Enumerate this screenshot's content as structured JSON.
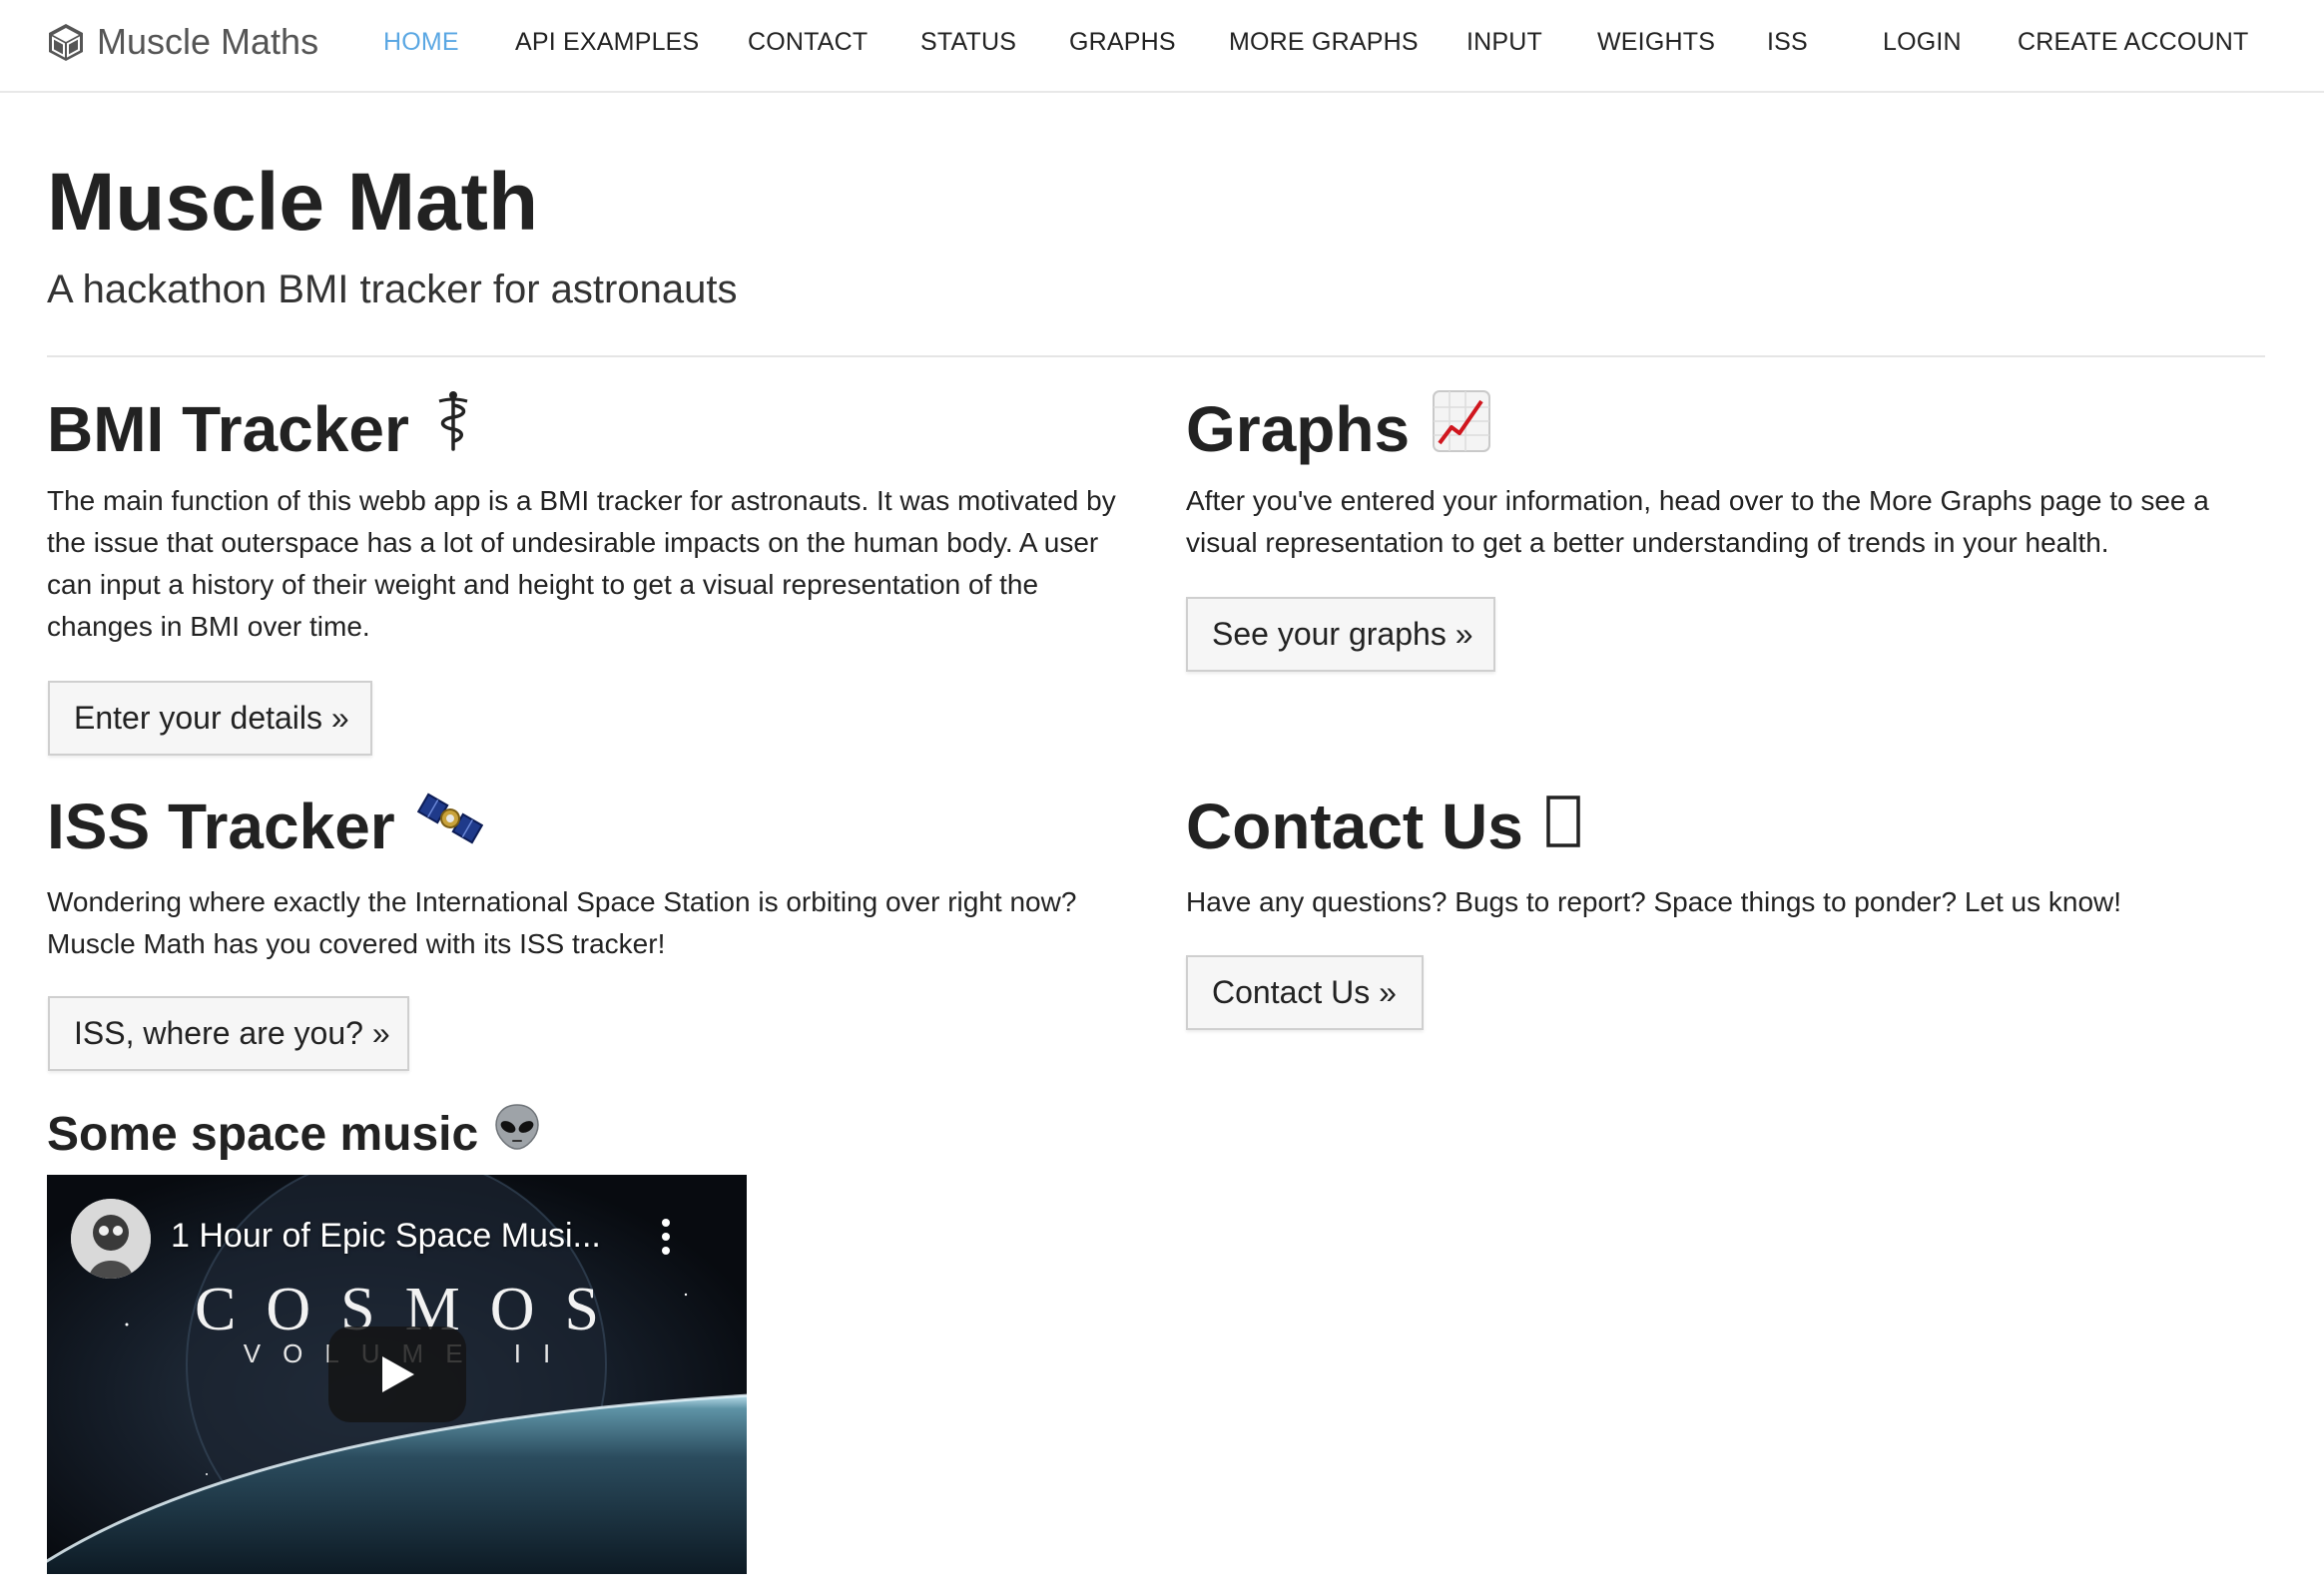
{
  "navbar": {
    "brand": "Muscle Maths",
    "brand_icon": "cube-icon",
    "links": [
      {
        "label": "HOME",
        "active": true
      },
      {
        "label": "API EXAMPLES",
        "active": false
      },
      {
        "label": "CONTACT",
        "active": false
      },
      {
        "label": "STATUS",
        "active": false
      },
      {
        "label": "GRAPHS",
        "active": false
      },
      {
        "label": "MORE GRAPHS",
        "active": false
      },
      {
        "label": "INPUT",
        "active": false
      },
      {
        "label": "WEIGHTS",
        "active": false
      },
      {
        "label": "ISS",
        "active": false
      }
    ],
    "login": "LOGIN",
    "create_account": "CREATE ACCOUNT",
    "active_color": "#5aa7e3"
  },
  "hero": {
    "title": "Muscle Math",
    "subtitle": "A hackathon BMI tracker for astronauts"
  },
  "sections": {
    "bmi": {
      "title": "BMI Tracker",
      "emoji": "medical-staff-icon",
      "text": "The main function of this webb app is a BMI tracker for astronauts. It was motivated by the issue that outerspace has a lot of undesirable impacts on the human body. A user can input a history of their weight and height to get a visual representation of the changes in BMI over time.",
      "button": "Enter your details »"
    },
    "graphs": {
      "title": "Graphs",
      "emoji": "chart-increasing-icon",
      "text": "After you've entered your information, head over to the More Graphs page to see a visual representation to get a better understanding of trends in your health.",
      "button": "See your graphs »"
    },
    "iss": {
      "title": "ISS Tracker",
      "emoji": "satellite-icon",
      "text": "Wondering where exactly the International Space Station is orbiting over right now? Muscle Math has you covered with its ISS tracker!",
      "button": "ISS, where are you? »"
    },
    "contact": {
      "title": "Contact Us",
      "emoji": "missing-glyph-icon",
      "text": "Have any questions? Bugs to report? Space things to ponder? Let us know!",
      "button": "Contact Us »"
    }
  },
  "music": {
    "title": "Some space music",
    "emoji": "alien-icon",
    "video": {
      "title": "1 Hour of Epic Space Musi...",
      "cover_title": "COSMOS",
      "cover_subtitle": "VOLUME II",
      "play_icon": "play-icon",
      "menu_icon": "more-vertical-icon"
    }
  }
}
